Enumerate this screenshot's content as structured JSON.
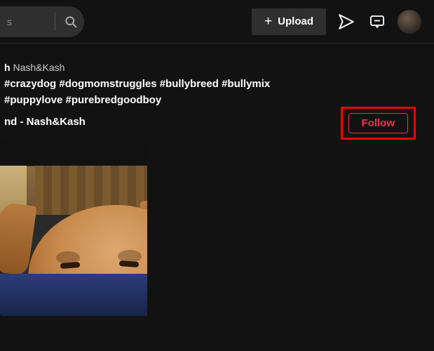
{
  "topbar": {
    "search_placeholder": "s",
    "upload_label": "Upload"
  },
  "post": {
    "username_suffix": "Nash&Kash",
    "username_prefix": "h",
    "hashtags": "#crazydog #dogmomstruggles #bullybreed #bullymix #puppylove #purebredgoodboy",
    "sound": "nd - Nash&Kash",
    "follow_label": "Follow"
  }
}
